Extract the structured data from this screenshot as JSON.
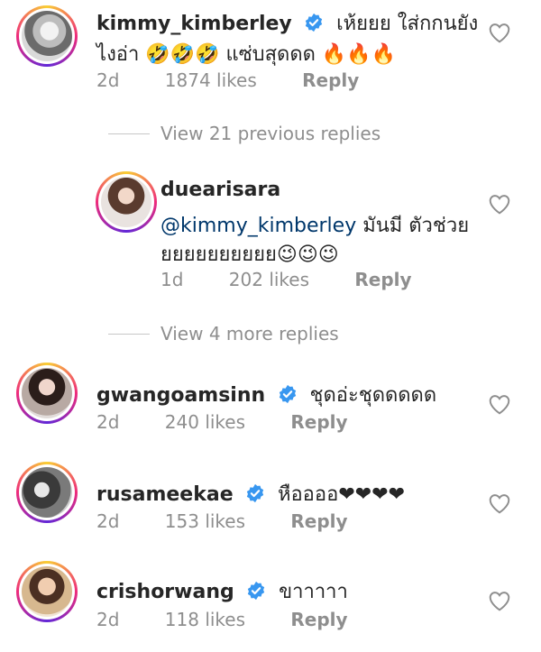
{
  "colors": {
    "verified": "#3897f0",
    "meta": "#8e8e8e",
    "mention": "#00376b"
  },
  "comments": [
    {
      "username": "kimmy_kimberley",
      "verified": true,
      "text_line1": "เห้ยยย ใส่กกนยัง",
      "text_line2": "ไงอ่า 🤣🤣🤣 แซ่บสุดดด 🔥🔥🔥",
      "time": "2d",
      "likes": "1874 likes",
      "reply": "Reply"
    },
    {
      "username": "duearisara",
      "verified": false,
      "mention": "@kimmy_kimberley",
      "text_after_mention": "มันมี ตัวช่วย",
      "text_line2": "ยยยยยยยยยย😉😉😉",
      "time": "1d",
      "likes": "202 likes",
      "reply": "Reply"
    },
    {
      "username": "gwangoamsinn",
      "verified": true,
      "text": "ชุดอ่ะชุดดดดด",
      "time": "2d",
      "likes": "240 likes",
      "reply": "Reply"
    },
    {
      "username": "rusameekae",
      "verified": true,
      "text": "หืออออ❤❤❤❤",
      "time": "2d",
      "likes": "153 likes",
      "reply": "Reply"
    },
    {
      "username": "crishorwang",
      "verified": true,
      "text": "ขาาาาา",
      "time": "2d",
      "likes": "118 likes",
      "reply": "Reply"
    }
  ],
  "view_replies": {
    "previous": "View 21 previous replies",
    "more": "View 4 more replies"
  },
  "icons": {
    "like": "heart-outline-icon",
    "verified": "verified-badge-icon"
  }
}
